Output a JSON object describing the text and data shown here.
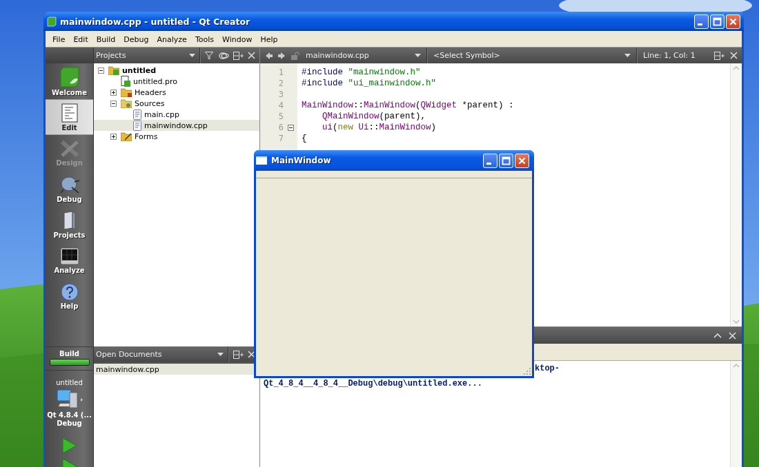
{
  "window": {
    "title": "mainwindow.cpp - untitled - Qt Creator"
  },
  "menu": [
    "File",
    "Edit",
    "Build",
    "Debug",
    "Analyze",
    "Tools",
    "Window",
    "Help"
  ],
  "modes": [
    {
      "label": "Welcome",
      "kind": "welcome",
      "selected": false,
      "disabled": false
    },
    {
      "label": "Edit",
      "kind": "edit",
      "selected": true,
      "disabled": false
    },
    {
      "label": "Design",
      "kind": "design",
      "selected": false,
      "disabled": true
    },
    {
      "label": "Debug",
      "kind": "debug",
      "selected": false,
      "disabled": false
    },
    {
      "label": "Projects",
      "kind": "projects",
      "selected": false,
      "disabled": false
    },
    {
      "label": "Analyze",
      "kind": "analyze",
      "selected": false,
      "disabled": false
    },
    {
      "label": "Help",
      "kind": "help",
      "selected": false,
      "disabled": false
    }
  ],
  "build": {
    "label": "Build",
    "level": 1
  },
  "target": {
    "project": "untitled",
    "kit": "Qt 4.8.4 (...",
    "config": "Debug"
  },
  "projects": {
    "title": "Projects",
    "tree": [
      {
        "label": "untitled",
        "kind": "project",
        "expanded": true,
        "selected": false,
        "children": [
          {
            "label": "untitled.pro",
            "kind": "pro-file",
            "selected": false
          },
          {
            "label": "Headers",
            "kind": "headers-folder",
            "expanded": false,
            "selected": false
          },
          {
            "label": "Sources",
            "kind": "sources-folder",
            "expanded": true,
            "selected": false,
            "children": [
              {
                "label": "main.cpp",
                "kind": "file",
                "selected": false
              },
              {
                "label": "mainwindow.cpp",
                "kind": "file",
                "selected": true
              }
            ]
          },
          {
            "label": "Forms",
            "kind": "forms-folder",
            "expanded": false,
            "selected": false
          }
        ]
      }
    ]
  },
  "open_documents": {
    "title": "Open Documents",
    "items": [
      {
        "label": "mainwindow.cpp",
        "selected": true
      }
    ]
  },
  "editor": {
    "file": "mainwindow.cpp",
    "symbol": "<Select Symbol>",
    "position": "Line: 1, Col: 1",
    "lines": [
      {
        "number": "1",
        "foldable": false,
        "tokens": [
          {
            "kind": "preproc",
            "text": "#include "
          },
          {
            "kind": "string",
            "text": "\"mainwindow.h\""
          }
        ]
      },
      {
        "number": "2",
        "foldable": false,
        "tokens": [
          {
            "kind": "preproc",
            "text": "#include "
          },
          {
            "kind": "string",
            "text": "\"ui_mainwindow.h\""
          }
        ]
      },
      {
        "number": "3",
        "foldable": false
      },
      {
        "number": "4",
        "foldable": false,
        "tokens": [
          {
            "kind": "type",
            "text": "MainWindow"
          },
          {
            "kind": "plain",
            "text": "::"
          },
          {
            "kind": "type",
            "text": "MainWindow"
          },
          {
            "kind": "plain",
            "text": "("
          },
          {
            "kind": "type",
            "text": "QWidget"
          },
          {
            "kind": "plain",
            "text": " *parent) :"
          }
        ]
      },
      {
        "number": "5",
        "foldable": false,
        "tokens": [
          {
            "kind": "type",
            "text": "    QMainWindow"
          },
          {
            "kind": "plain",
            "text": "(parent),"
          }
        ]
      },
      {
        "number": "6",
        "foldable": true,
        "tokens": [
          {
            "kind": "member",
            "text": "    ui"
          },
          {
            "kind": "plain",
            "text": "("
          },
          {
            "kind": "keyword",
            "text": "new "
          },
          {
            "kind": "type",
            "text": "Ui"
          },
          {
            "kind": "plain",
            "text": "::"
          },
          {
            "kind": "type",
            "text": "MainWindow"
          },
          {
            "kind": "plain",
            "text": ")"
          }
        ]
      },
      {
        "number": "7",
        "foldable": false,
        "tokens": [
          {
            "kind": "plain",
            "text": "{"
          }
        ]
      }
    ]
  },
  "output": {
    "lines": [
      "ktop-",
      "Qt_4_8_4__4_8_4__Debug\\debug\\untitled.exe..."
    ]
  },
  "dialog": {
    "title": "MainWindow"
  }
}
